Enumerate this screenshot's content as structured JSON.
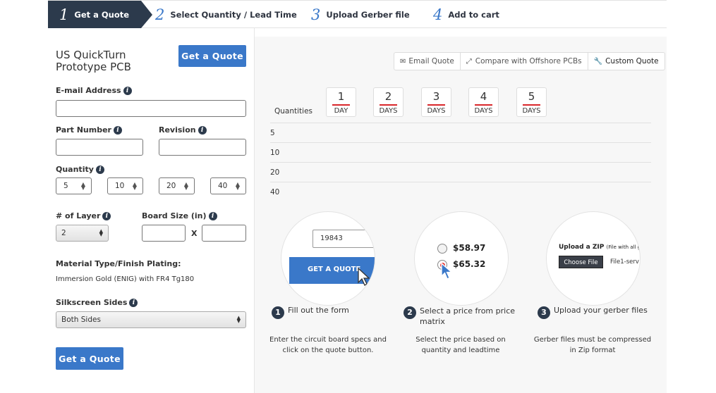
{
  "steps": [
    {
      "num": "1",
      "label": "Get a Quote"
    },
    {
      "num": "2",
      "label": "Select Quantity / Lead Time"
    },
    {
      "num": "3",
      "label": "Upload Gerber file"
    },
    {
      "num": "4",
      "label": "Add to cart"
    }
  ],
  "form": {
    "title_line1": "US QuickTurn",
    "title_line2": "Prototype PCB",
    "top_button": "Get a Quote",
    "email_label": "E-mail Address",
    "part_label": "Part Number",
    "revision_label": "Revision",
    "quantity_label": "Quantity",
    "quantities": [
      "5",
      "10",
      "20",
      "40"
    ],
    "layer_label": "# of Layer",
    "layer_value": "2",
    "board_label": "Board Size (in)",
    "board_x": "X",
    "material_label": "Material Type/Finish Plating:",
    "material_value": "Immersion Gold (ENIG) with FR4 Tg180",
    "silk_label": "Silkscreen Sides",
    "silk_value": "Both Sides",
    "bottom_button": "Get a Quote"
  },
  "toolbar": {
    "email": "Email Quote",
    "compare": "Compare with Offshore PCBs",
    "custom": "Custom Quote"
  },
  "matrix": {
    "quantities_label": "Quantities",
    "days": [
      {
        "n": "1",
        "u": "DAY"
      },
      {
        "n": "2",
        "u": "DAYS"
      },
      {
        "n": "3",
        "u": "DAYS"
      },
      {
        "n": "4",
        "u": "DAYS"
      },
      {
        "n": "5",
        "u": "DAYS"
      }
    ],
    "rows": [
      "5",
      "10",
      "20",
      "40"
    ]
  },
  "howto": {
    "c1_input": "19843",
    "c1_button": "GET A QUOTE",
    "c2_price1": "$58.97",
    "c2_price2": "$65.32",
    "c3_title": "Upload a ZIP",
    "c3_note": "(File with all g",
    "c3_choose": "Choose File",
    "c3_file": "File1-serv",
    "steps": [
      {
        "n": "1",
        "title": "Fill out the form",
        "desc": "Enter the circuit board specs and click on the quote button."
      },
      {
        "n": "2",
        "title": "Select a price from price matrix",
        "desc": "Select the price based on quantity and leadtime"
      },
      {
        "n": "3",
        "title": "Upload your gerber files",
        "desc": "Gerber files must be compressed in Zip format"
      }
    ]
  },
  "colors": {
    "accent": "#3a78c9",
    "dark": "#2c3a4c",
    "red": "#d9262a"
  }
}
